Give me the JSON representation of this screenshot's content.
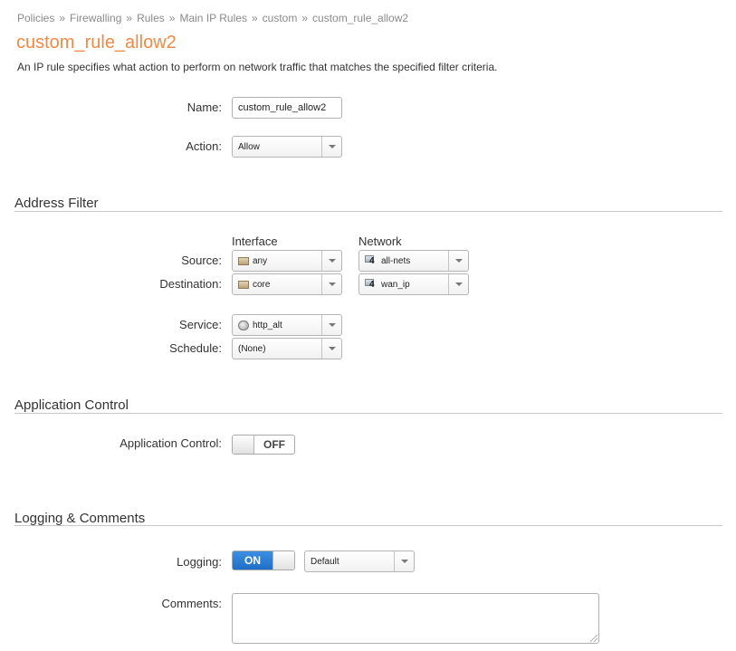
{
  "breadcrumb": [
    "Policies",
    "Firewalling",
    "Rules",
    "Main IP Rules",
    "custom",
    "custom_rule_allow2"
  ],
  "breadcrumb_separator": "»",
  "page": {
    "title": "custom_rule_allow2",
    "description": "An IP rule specifies what action to perform on network traffic that matches the specified filter criteria."
  },
  "general": {
    "name_label": "Name:",
    "name_value": "custom_rule_allow2",
    "action_label": "Action:",
    "action_value": "Allow"
  },
  "address_filter": {
    "heading": "Address Filter",
    "interface_header": "Interface",
    "network_header": "Network",
    "source_label": "Source:",
    "source_interface": "any",
    "source_network": "all-nets",
    "destination_label": "Destination:",
    "destination_interface": "core",
    "destination_network": "wan_ip",
    "network_icon_badge": "4",
    "service_label": "Service:",
    "service_value": "http_alt",
    "schedule_label": "Schedule:",
    "schedule_value": "(None)"
  },
  "application_control": {
    "heading": "Application Control",
    "label": "Application Control:",
    "toggle_state": "OFF"
  },
  "logging": {
    "heading": "Logging & Comments",
    "logging_label": "Logging:",
    "logging_state": "ON",
    "logging_level": "Default",
    "comments_label": "Comments:",
    "comments_value": ""
  },
  "colors": {
    "title": "#f08a45",
    "toggle_on": "#1f6fc8",
    "section_rule": "#c8c8c8"
  },
  "icons": {
    "interface": "interface-icon",
    "network": "network-object-icon",
    "service": "service-icon",
    "dropdown": "chevron-down-icon"
  }
}
